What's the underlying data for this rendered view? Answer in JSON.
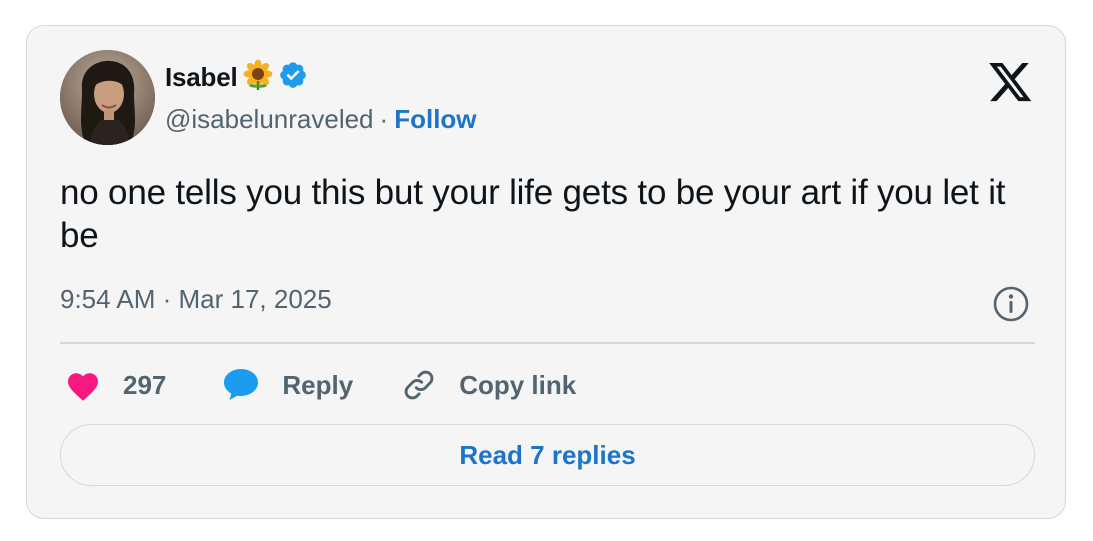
{
  "tweet": {
    "author": {
      "display_name": "Isabel",
      "handle": "@isabelunraveled",
      "verified": true,
      "name_emoji": "sunflower-icon",
      "avatar": "profile-photo"
    },
    "separator": "·",
    "follow_label": "Follow",
    "text": "no one tells you this but your life gets to be your art if you let it be",
    "timestamp": "9:54 AM · Mar 17, 2025",
    "actions": {
      "like_count": "297",
      "reply_label": "Reply",
      "copy_label": "Copy link"
    },
    "read_replies_label": "Read 7 replies"
  },
  "colors": {
    "card_background": "#f5f5f5",
    "border": "#cfd9de",
    "text_primary": "#0f1419",
    "text_secondary": "#536471",
    "link_blue": "#1d74c8",
    "verified_blue": "#1d9bf0",
    "like_pink": "#f91880"
  }
}
